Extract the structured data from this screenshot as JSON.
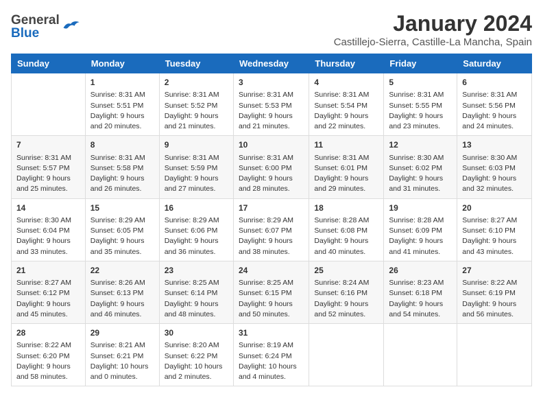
{
  "header": {
    "logo_general": "General",
    "logo_blue": "Blue",
    "month": "January 2024",
    "location": "Castillejo-Sierra, Castille-La Mancha, Spain"
  },
  "days_of_week": [
    "Sunday",
    "Monday",
    "Tuesday",
    "Wednesday",
    "Thursday",
    "Friday",
    "Saturday"
  ],
  "weeks": [
    [
      {
        "day": "",
        "info": ""
      },
      {
        "day": "1",
        "info": "Sunrise: 8:31 AM\nSunset: 5:51 PM\nDaylight: 9 hours\nand 20 minutes."
      },
      {
        "day": "2",
        "info": "Sunrise: 8:31 AM\nSunset: 5:52 PM\nDaylight: 9 hours\nand 21 minutes."
      },
      {
        "day": "3",
        "info": "Sunrise: 8:31 AM\nSunset: 5:53 PM\nDaylight: 9 hours\nand 21 minutes."
      },
      {
        "day": "4",
        "info": "Sunrise: 8:31 AM\nSunset: 5:54 PM\nDaylight: 9 hours\nand 22 minutes."
      },
      {
        "day": "5",
        "info": "Sunrise: 8:31 AM\nSunset: 5:55 PM\nDaylight: 9 hours\nand 23 minutes."
      },
      {
        "day": "6",
        "info": "Sunrise: 8:31 AM\nSunset: 5:56 PM\nDaylight: 9 hours\nand 24 minutes."
      }
    ],
    [
      {
        "day": "7",
        "info": "Sunrise: 8:31 AM\nSunset: 5:57 PM\nDaylight: 9 hours\nand 25 minutes."
      },
      {
        "day": "8",
        "info": "Sunrise: 8:31 AM\nSunset: 5:58 PM\nDaylight: 9 hours\nand 26 minutes."
      },
      {
        "day": "9",
        "info": "Sunrise: 8:31 AM\nSunset: 5:59 PM\nDaylight: 9 hours\nand 27 minutes."
      },
      {
        "day": "10",
        "info": "Sunrise: 8:31 AM\nSunset: 6:00 PM\nDaylight: 9 hours\nand 28 minutes."
      },
      {
        "day": "11",
        "info": "Sunrise: 8:31 AM\nSunset: 6:01 PM\nDaylight: 9 hours\nand 29 minutes."
      },
      {
        "day": "12",
        "info": "Sunrise: 8:30 AM\nSunset: 6:02 PM\nDaylight: 9 hours\nand 31 minutes."
      },
      {
        "day": "13",
        "info": "Sunrise: 8:30 AM\nSunset: 6:03 PM\nDaylight: 9 hours\nand 32 minutes."
      }
    ],
    [
      {
        "day": "14",
        "info": "Sunrise: 8:30 AM\nSunset: 6:04 PM\nDaylight: 9 hours\nand 33 minutes."
      },
      {
        "day": "15",
        "info": "Sunrise: 8:29 AM\nSunset: 6:05 PM\nDaylight: 9 hours\nand 35 minutes."
      },
      {
        "day": "16",
        "info": "Sunrise: 8:29 AM\nSunset: 6:06 PM\nDaylight: 9 hours\nand 36 minutes."
      },
      {
        "day": "17",
        "info": "Sunrise: 8:29 AM\nSunset: 6:07 PM\nDaylight: 9 hours\nand 38 minutes."
      },
      {
        "day": "18",
        "info": "Sunrise: 8:28 AM\nSunset: 6:08 PM\nDaylight: 9 hours\nand 40 minutes."
      },
      {
        "day": "19",
        "info": "Sunrise: 8:28 AM\nSunset: 6:09 PM\nDaylight: 9 hours\nand 41 minutes."
      },
      {
        "day": "20",
        "info": "Sunrise: 8:27 AM\nSunset: 6:10 PM\nDaylight: 9 hours\nand 43 minutes."
      }
    ],
    [
      {
        "day": "21",
        "info": "Sunrise: 8:27 AM\nSunset: 6:12 PM\nDaylight: 9 hours\nand 45 minutes."
      },
      {
        "day": "22",
        "info": "Sunrise: 8:26 AM\nSunset: 6:13 PM\nDaylight: 9 hours\nand 46 minutes."
      },
      {
        "day": "23",
        "info": "Sunrise: 8:25 AM\nSunset: 6:14 PM\nDaylight: 9 hours\nand 48 minutes."
      },
      {
        "day": "24",
        "info": "Sunrise: 8:25 AM\nSunset: 6:15 PM\nDaylight: 9 hours\nand 50 minutes."
      },
      {
        "day": "25",
        "info": "Sunrise: 8:24 AM\nSunset: 6:16 PM\nDaylight: 9 hours\nand 52 minutes."
      },
      {
        "day": "26",
        "info": "Sunrise: 8:23 AM\nSunset: 6:18 PM\nDaylight: 9 hours\nand 54 minutes."
      },
      {
        "day": "27",
        "info": "Sunrise: 8:22 AM\nSunset: 6:19 PM\nDaylight: 9 hours\nand 56 minutes."
      }
    ],
    [
      {
        "day": "28",
        "info": "Sunrise: 8:22 AM\nSunset: 6:20 PM\nDaylight: 9 hours\nand 58 minutes."
      },
      {
        "day": "29",
        "info": "Sunrise: 8:21 AM\nSunset: 6:21 PM\nDaylight: 10 hours\nand 0 minutes."
      },
      {
        "day": "30",
        "info": "Sunrise: 8:20 AM\nSunset: 6:22 PM\nDaylight: 10 hours\nand 2 minutes."
      },
      {
        "day": "31",
        "info": "Sunrise: 8:19 AM\nSunset: 6:24 PM\nDaylight: 10 hours\nand 4 minutes."
      },
      {
        "day": "",
        "info": ""
      },
      {
        "day": "",
        "info": ""
      },
      {
        "day": "",
        "info": ""
      }
    ]
  ]
}
